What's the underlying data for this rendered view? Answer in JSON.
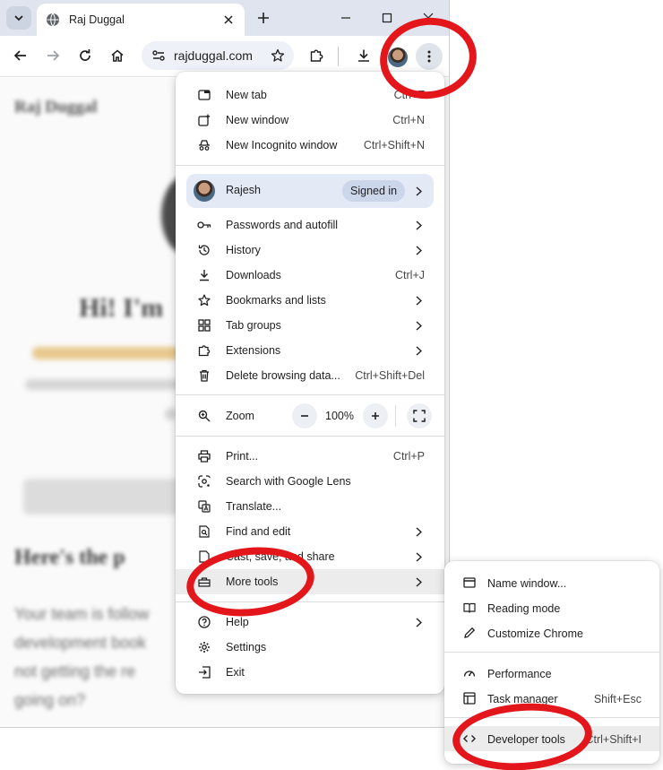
{
  "browser": {
    "tab_title": "Raj Duggal",
    "url": "rajduggal.com"
  },
  "page": {
    "heading_top": "Raj Duggal",
    "hero_heading": "Hi! I'm",
    "section_heading": "Here's the p",
    "para_lines": [
      "Your team is follow",
      "development book",
      "not getting the re",
      "going on?"
    ]
  },
  "menu": {
    "group1": [
      {
        "label": "New tab",
        "shortcut": "Ctrl+T",
        "icon": "new-tab-icon"
      },
      {
        "label": "New window",
        "shortcut": "Ctrl+N",
        "icon": "new-window-icon"
      },
      {
        "label": "New Incognito window",
        "shortcut": "Ctrl+Shift+N",
        "icon": "incognito-icon"
      }
    ],
    "profile": {
      "name": "Rajesh",
      "status": "Signed in"
    },
    "group2": [
      {
        "label": "Passwords and autofill",
        "shortcut": "",
        "icon": "key-icon"
      },
      {
        "label": "History",
        "shortcut": "",
        "icon": "history-icon"
      },
      {
        "label": "Downloads",
        "shortcut": "Ctrl+J",
        "icon": "download-icon"
      },
      {
        "label": "Bookmarks and lists",
        "shortcut": "",
        "icon": "star-icon"
      },
      {
        "label": "Tab groups",
        "shortcut": "",
        "icon": "tab-groups-icon"
      },
      {
        "label": "Extensions",
        "shortcut": "",
        "icon": "puzzle-icon"
      },
      {
        "label": "Delete browsing data...",
        "shortcut": "Ctrl+Shift+Del",
        "icon": "trash-icon"
      }
    ],
    "zoom": {
      "label": "Zoom",
      "value": "100%",
      "minus": "−",
      "plus": "+"
    },
    "group3": [
      {
        "label": "Print...",
        "shortcut": "Ctrl+P",
        "icon": "print-icon"
      },
      {
        "label": "Search with Google Lens",
        "shortcut": "",
        "icon": "lens-icon"
      },
      {
        "label": "Translate...",
        "shortcut": "",
        "icon": "translate-icon"
      },
      {
        "label": "Find and edit",
        "shortcut": "",
        "icon": "find-icon"
      },
      {
        "label": "Cast, save, and share",
        "shortcut": "",
        "icon": "cast-icon"
      },
      {
        "label": "More tools",
        "shortcut": "",
        "icon": "toolbox-icon"
      }
    ],
    "group4": [
      {
        "label": "Help",
        "shortcut": "",
        "icon": "help-icon"
      },
      {
        "label": "Settings",
        "shortcut": "",
        "icon": "gear-icon"
      },
      {
        "label": "Exit",
        "shortcut": "",
        "icon": "exit-icon"
      }
    ]
  },
  "submenu": {
    "group1": [
      {
        "label": "Name window...",
        "shortcut": "",
        "icon": "window-icon"
      },
      {
        "label": "Reading mode",
        "shortcut": "",
        "icon": "book-icon"
      },
      {
        "label": "Customize Chrome",
        "shortcut": "",
        "icon": "pen-icon"
      }
    ],
    "group2": [
      {
        "label": "Performance",
        "shortcut": "",
        "icon": "speedometer-icon"
      },
      {
        "label": "Task manager",
        "shortcut": "Shift+Esc",
        "icon": "task-manager-icon"
      }
    ],
    "group3": [
      {
        "label": "Developer tools",
        "shortcut": "Ctrl+Shift+I",
        "icon": "code-icon"
      }
    ]
  },
  "colors": {
    "annotation": "#e3161c",
    "accent": "#0b57d0"
  }
}
